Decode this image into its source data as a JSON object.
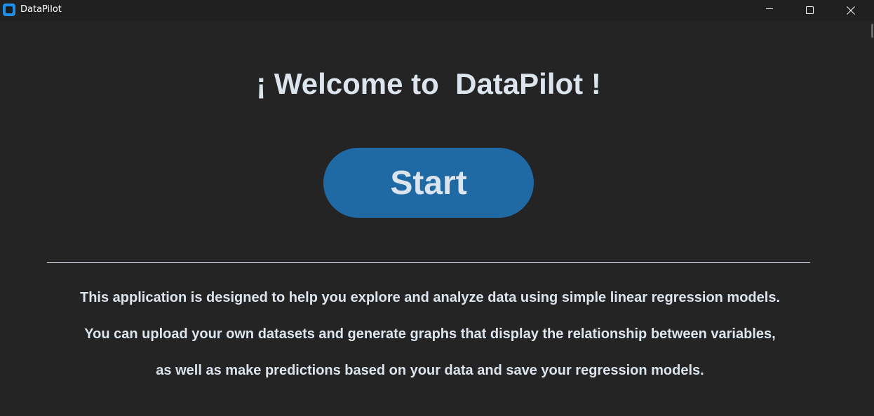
{
  "window": {
    "title": "DataPilot",
    "icon": "app-logo-icon",
    "controls": [
      "minimize-icon",
      "maximize-icon",
      "close-icon"
    ]
  },
  "main": {
    "heading": "¡ Welcome to  DataPilot !",
    "start_label": "Start",
    "description": [
      "This application is designed to help you explore and analyze data using simple linear regression models.",
      "You can upload your own datasets and generate graphs that display the relationship between variables,",
      "as well as make predictions based on your data and save your regression models."
    ]
  },
  "colors": {
    "background": "#242424",
    "titlebar": "#202020",
    "accent": "#1f6aa5",
    "text": "#dce4ee"
  }
}
